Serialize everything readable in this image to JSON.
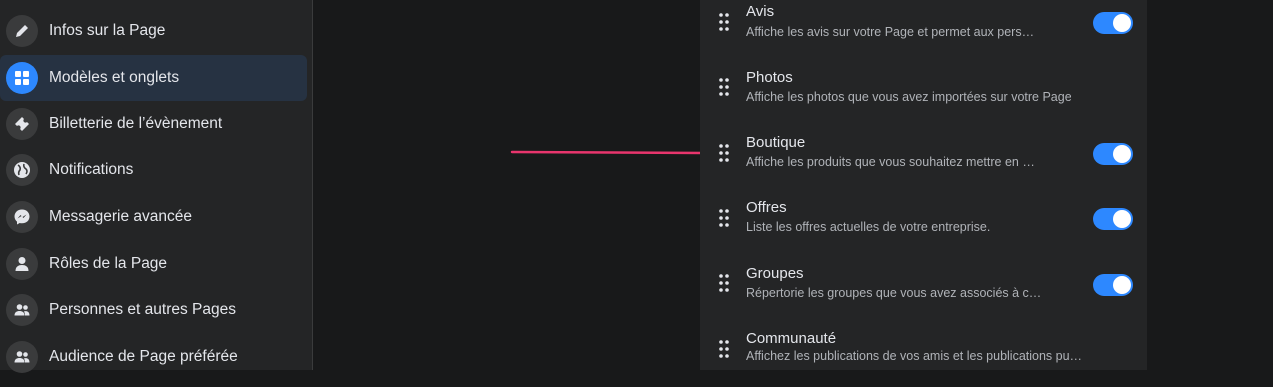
{
  "sidebar": {
    "items": [
      {
        "label": "Infos sur la Page",
        "icon": "pencil-icon",
        "active": false
      },
      {
        "label": "Modèles et onglets",
        "icon": "grid-icon",
        "active": true
      },
      {
        "label": "Billetterie de l’évènement",
        "icon": "ticket-icon",
        "active": false
      },
      {
        "label": "Notifications",
        "icon": "globe-icon",
        "active": false
      },
      {
        "label": "Messagerie avancée",
        "icon": "messenger-icon",
        "active": false
      },
      {
        "label": "Rôles de la Page",
        "icon": "person-icon",
        "active": false
      },
      {
        "label": "Personnes et autres Pages",
        "icon": "people-icon",
        "active": false
      },
      {
        "label": "Audience de Page préférée",
        "icon": "people-icon",
        "active": false
      }
    ]
  },
  "tabs_panel": {
    "rows": [
      {
        "title": "Avis",
        "description": "Affiche les avis sur votre Page et permet aux pers…",
        "toggle_on": true
      },
      {
        "title": "Photos",
        "description": "Affiche les photos que vous avez importées sur votre Page.",
        "toggle_on": null
      },
      {
        "title": "Boutique",
        "description": "Affiche les produits que vous souhaitez mettre en …",
        "toggle_on": true
      },
      {
        "title": "Offres",
        "description": "Liste les offres actuelles de votre entreprise.",
        "toggle_on": true
      },
      {
        "title": "Groupes",
        "description": "Répertorie les groupes que vous avez associés à c…",
        "toggle_on": true
      },
      {
        "title": "Communauté",
        "description": "Affichez les publications de vos amis et les publications pu…",
        "toggle_on": null
      }
    ]
  },
  "colors": {
    "background": "#18191a",
    "panel": "#242526",
    "accent": "#2d88ff",
    "active_item": "#263242",
    "arrow": "#e8356d"
  }
}
